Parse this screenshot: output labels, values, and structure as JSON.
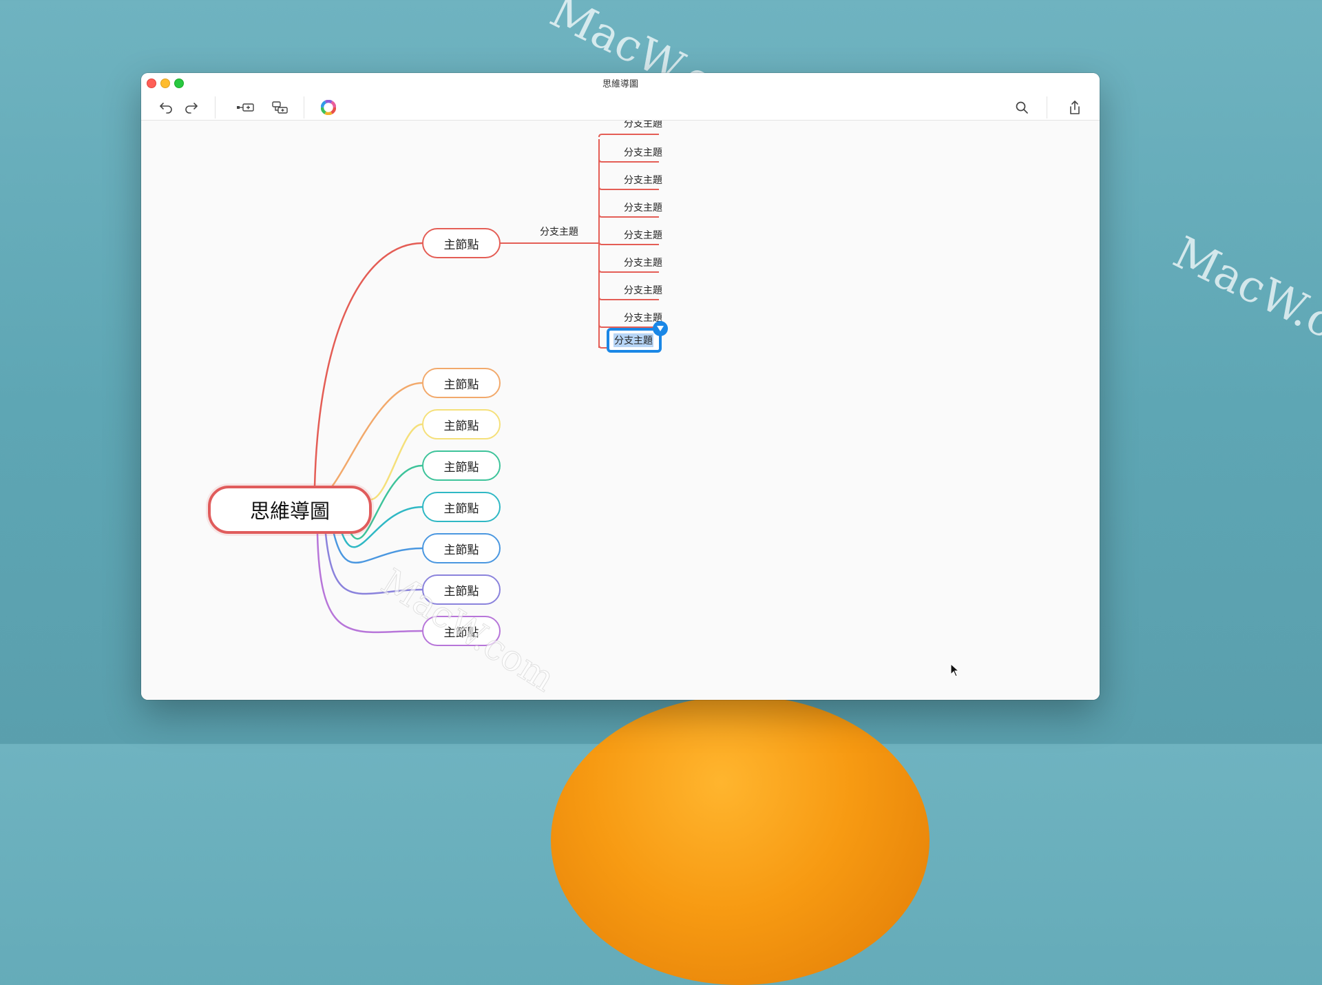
{
  "window": {
    "title": "思維導圖"
  },
  "toolbar": {
    "undo_icon": "undo-icon",
    "redo_icon": "redo-icon",
    "add_topic_icon": "add-topic-icon",
    "add_subtopic_icon": "add-subtopic-icon",
    "theme_icon": "color-wheel-icon",
    "search_icon": "search-icon",
    "share_icon": "share-icon"
  },
  "mindmap": {
    "root": {
      "label": "思維導圖",
      "color": "#e05c5c"
    },
    "main_nodes": [
      {
        "label": "主節點",
        "color": "#e45d55"
      },
      {
        "label": "主節點",
        "color": "#f2a96b"
      },
      {
        "label": "主節點",
        "color": "#f5e07a"
      },
      {
        "label": "主節點",
        "color": "#3dc39a"
      },
      {
        "label": "主節點",
        "color": "#2fb8c4"
      },
      {
        "label": "主節點",
        "color": "#4a97e0"
      },
      {
        "label": "主節點",
        "color": "#8a82dc"
      },
      {
        "label": "主節點",
        "color": "#b775d9"
      }
    ],
    "branch_topic": {
      "label": "分支主題",
      "color": "#e45d55"
    },
    "sub_topics": [
      {
        "label": "分支主題"
      },
      {
        "label": "分支主題"
      },
      {
        "label": "分支主題"
      },
      {
        "label": "分支主題"
      },
      {
        "label": "分支主題"
      },
      {
        "label": "分支主題"
      },
      {
        "label": "分支主題"
      },
      {
        "label": "分支主題"
      },
      {
        "label": "分支主題",
        "selected": true
      }
    ],
    "selection_color": "#1a87e6"
  },
  "zoom": {
    "minus": "−",
    "plus": "+"
  },
  "watermark": {
    "text": "MacW.com"
  }
}
